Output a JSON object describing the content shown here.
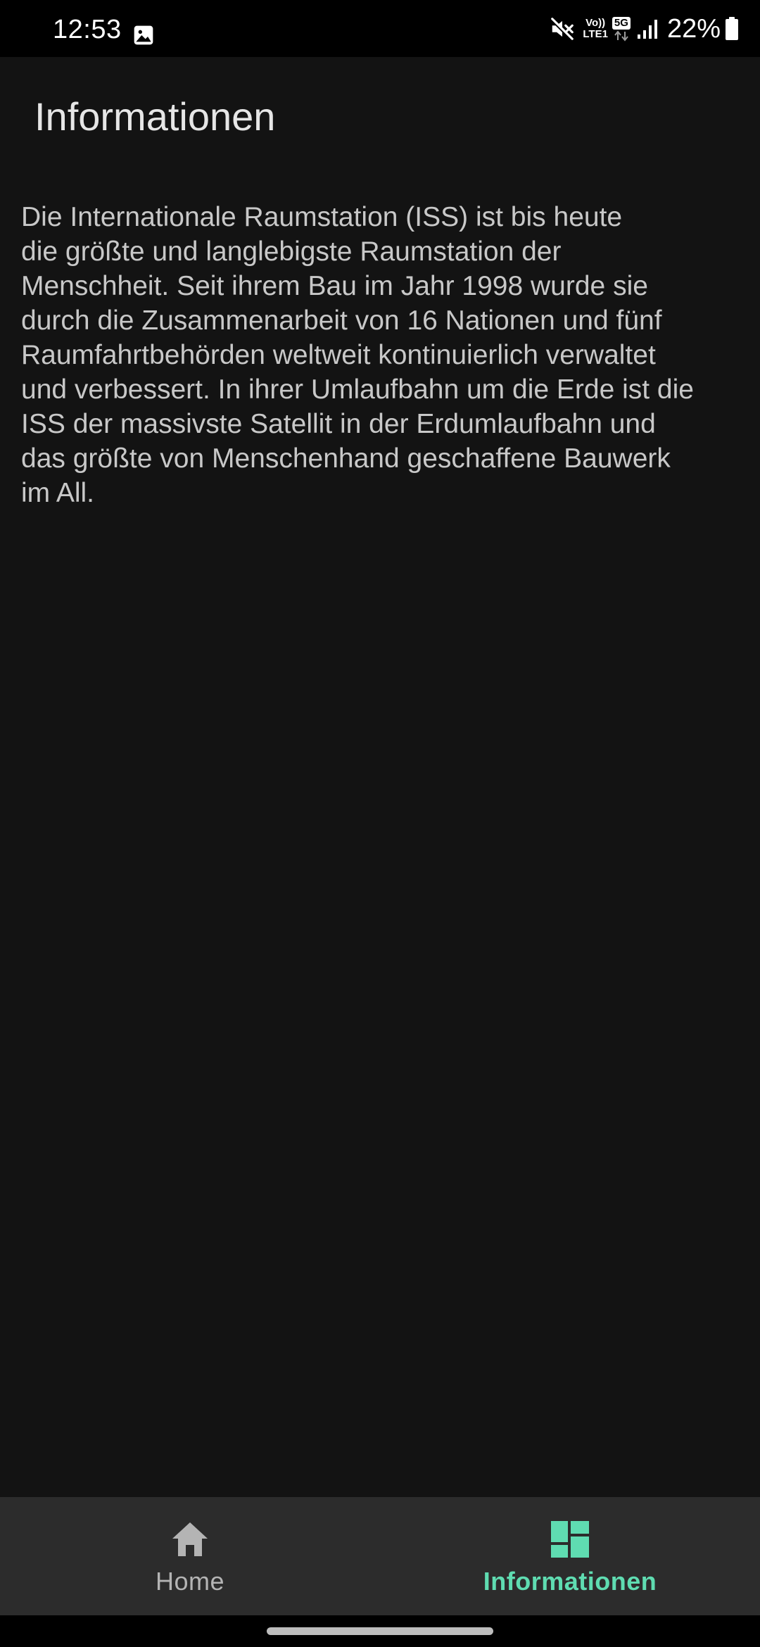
{
  "status_bar": {
    "time": "12:53",
    "volte_line1": "Vo))",
    "volte_line2": "LTE1",
    "network": "5G",
    "battery": "22%",
    "icons": [
      "gallery-icon",
      "mute-icon",
      "signal-icon",
      "battery-icon"
    ]
  },
  "header": {
    "title": "Informationen"
  },
  "content": {
    "text": "Die Internationale Raumstation (ISS) ist bis heute\ndie größte und langlebigste Raumstation der\nMenschheit. Seit ihrem Bau im Jahr 1998 wurde sie\ndurch die Zusammenarbeit von 16 Nationen und fünf\nRaumfahrtbehörden weltweit kontinuierlich verwaltet\nund verbessert. In ihrer Umlaufbahn um die Erde ist die\nISS der massivste Satellit in der Erdumlaufbahn und\ndas größte von Menschenhand geschaffene Bauwerk\nim All."
  },
  "bottom_nav": {
    "items": [
      {
        "label": "Home",
        "icon": "home-icon",
        "active": false
      },
      {
        "label": "Informationen",
        "icon": "dashboard-icon",
        "active": true
      }
    ]
  },
  "colors": {
    "background": "#131313",
    "nav_background": "#2c2c2c",
    "accent": "#5fdcb1",
    "inactive": "#b4b4b4",
    "text": "#c8c8c8"
  }
}
